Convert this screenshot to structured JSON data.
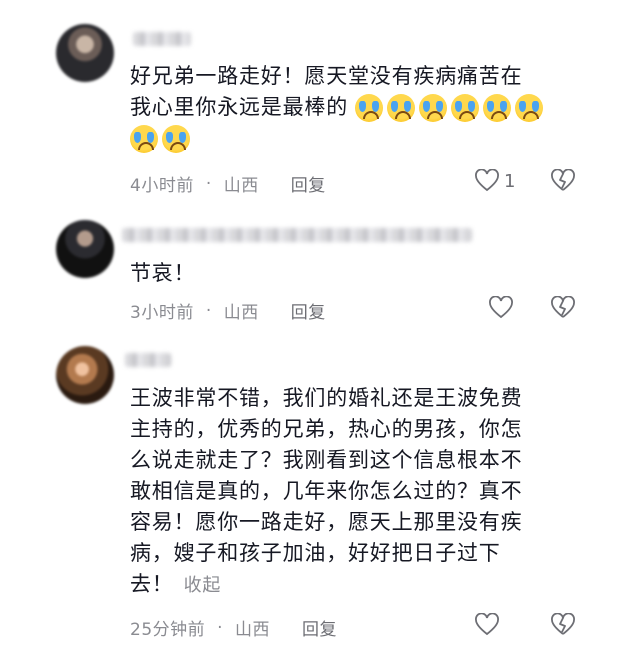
{
  "comments": [
    {
      "text_lines": [
        "好兄弟一路走好！愿天堂没有疾病痛苦在",
        "我心里你永远是最棒的"
      ],
      "emoji_icon": "loudly-crying-face-emoji",
      "emoji_count": 8,
      "time": "4小时前",
      "location": "山西",
      "reply_label": "回复",
      "like_count": "1"
    },
    {
      "text_lines": [
        "节哀！"
      ],
      "time": "3小时前",
      "location": "山西",
      "reply_label": "回复",
      "like_count": ""
    },
    {
      "text_lines": [
        "王波非常不错，我们的婚礼还是王波免费",
        "主持的，优秀的兄弟，热心的男孩，你怎",
        "么说走就走了？我刚看到这个信息根本不",
        "敢相信是真的，几年来你怎么过的？真不",
        "容易！愿你一路走好，愿天上那里没有疾",
        "病，嫂子和孩子加油，好好把日子过下",
        "去！"
      ],
      "collapse_label": "收起",
      "time": "25分钟前",
      "location": "山西",
      "reply_label": "回复",
      "like_count": ""
    }
  ],
  "separator": "·",
  "icons": {
    "like": "heart-outline-icon",
    "dislike": "broken-heart-icon"
  }
}
